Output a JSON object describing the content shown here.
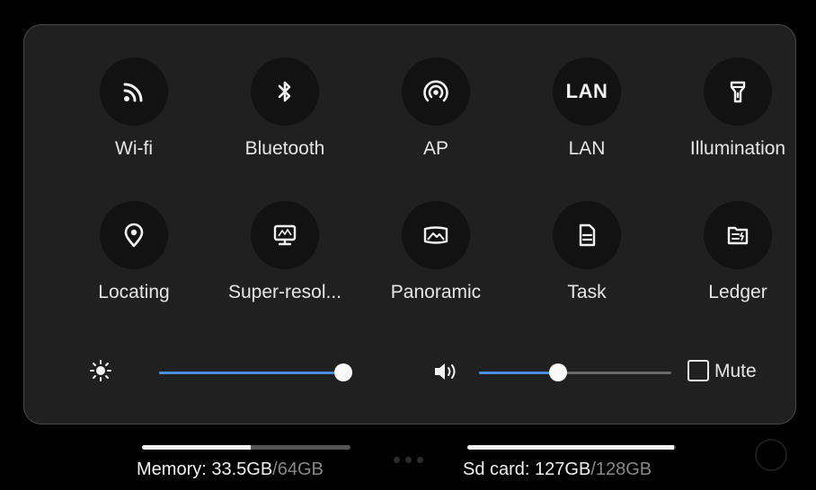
{
  "tiles": [
    {
      "label": "Wi-fi",
      "icon": "wifi-icon"
    },
    {
      "label": "Bluetooth",
      "icon": "bluetooth-icon"
    },
    {
      "label": "AP",
      "icon": "hotspot-icon"
    },
    {
      "label": "LAN",
      "icon": "lan-icon",
      "icon_text": "LAN"
    },
    {
      "label": "Illumination",
      "icon": "flashlight-icon"
    },
    {
      "label": "Locating",
      "icon": "location-pin-icon"
    },
    {
      "label": "Super-resol...",
      "icon": "monitor-icon"
    },
    {
      "label": "Panoramic",
      "icon": "panorama-icon"
    },
    {
      "label": "Task",
      "icon": "document-icon"
    },
    {
      "label": "Ledger",
      "icon": "ledger-icon"
    }
  ],
  "brightness": {
    "icon": "brightness-icon",
    "level": 1.0
  },
  "volume": {
    "icon": "volume-icon",
    "level": 0.41
  },
  "mute": {
    "label": "Mute",
    "checked": false
  },
  "storage": {
    "memory": {
      "label": "Memory: 33.5GB",
      "total": "/64GB",
      "fraction": 0.52
    },
    "sdcard": {
      "label": "Sd card: 127GB",
      "total": "/128GB",
      "fraction": 0.99
    }
  },
  "colors": {
    "accent": "#4a90e2",
    "panel": "#202020",
    "circle": "#121212"
  }
}
